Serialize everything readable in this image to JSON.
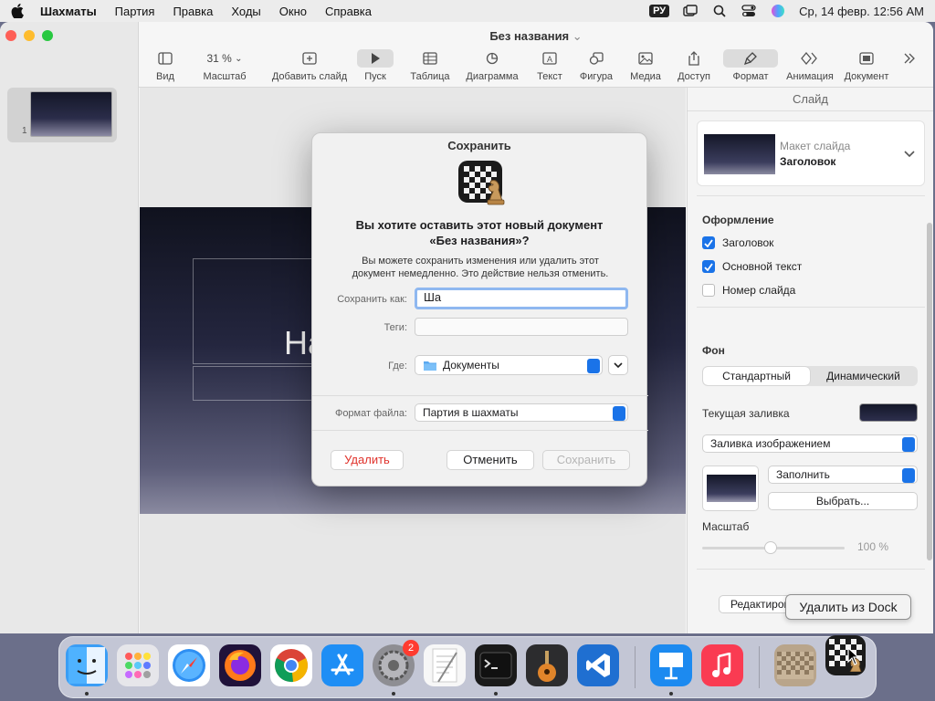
{
  "menubar": {
    "app": "Шахматы",
    "items": [
      "Партия",
      "Правка",
      "Ходы",
      "Окно",
      "Справка"
    ],
    "input_source": "РУ",
    "clock": "Ср, 14 февр.  12:56 AM"
  },
  "window": {
    "title": "Без названия",
    "zoom": "31 %",
    "tools": {
      "view": "Вид",
      "zoom": "Масштаб",
      "add_slide": "Добавить слайд",
      "play": "Пуск",
      "table": "Таблица",
      "chart": "Диаграмма",
      "text": "Текст",
      "shape": "Фигура",
      "media": "Медиа",
      "share": "Доступ",
      "format": "Формат",
      "animate": "Анимация",
      "document": "Документ"
    },
    "slide_number": "1",
    "slide_text": "На"
  },
  "inspector": {
    "title": "Слайд",
    "layout_label": "Макет слайда",
    "layout_value": "Заголовок",
    "appearance": "Оформление",
    "checks": [
      {
        "label": "Заголовок",
        "checked": true
      },
      {
        "label": "Основной текст",
        "checked": true
      },
      {
        "label": "Номер слайда",
        "checked": false
      }
    ],
    "background": "Фон",
    "seg_standard": "Стандартный",
    "seg_dynamic": "Динамический",
    "current_fill": "Текущая заливка",
    "fill_type": "Заливка изображением",
    "fill_mode": "Заполнить",
    "choose": "Выбрать...",
    "scale": "Масштаб",
    "scale_value": "100 %",
    "scale_slider_fraction": 0.45,
    "edit": "Редактировать"
  },
  "dialog": {
    "title": "Сохранить",
    "heading_line1": "Вы хотите оставить этот новый документ",
    "heading_line2": "«Без названия»?",
    "body_line1": "Вы можете сохранить изменения или удалить этот",
    "body_line2": "документ немедленно. Это действие нельзя отменить.",
    "save_as_label": "Сохранить как:",
    "save_as_value": "Ша",
    "tags_label": "Теги:",
    "where_label": "Где:",
    "where_value": "Документы",
    "format_label": "Формат файла:",
    "format_value": "Партия в шахматы",
    "delete": "Удалить",
    "cancel": "Отменить",
    "save": "Сохранить"
  },
  "dock": {
    "tooltip": "Удалить из Dock",
    "settings_badge": "2"
  },
  "colors": {
    "accent": "#1a73e8",
    "delete_red": "#e0322b",
    "badge": "#ff3b30"
  }
}
